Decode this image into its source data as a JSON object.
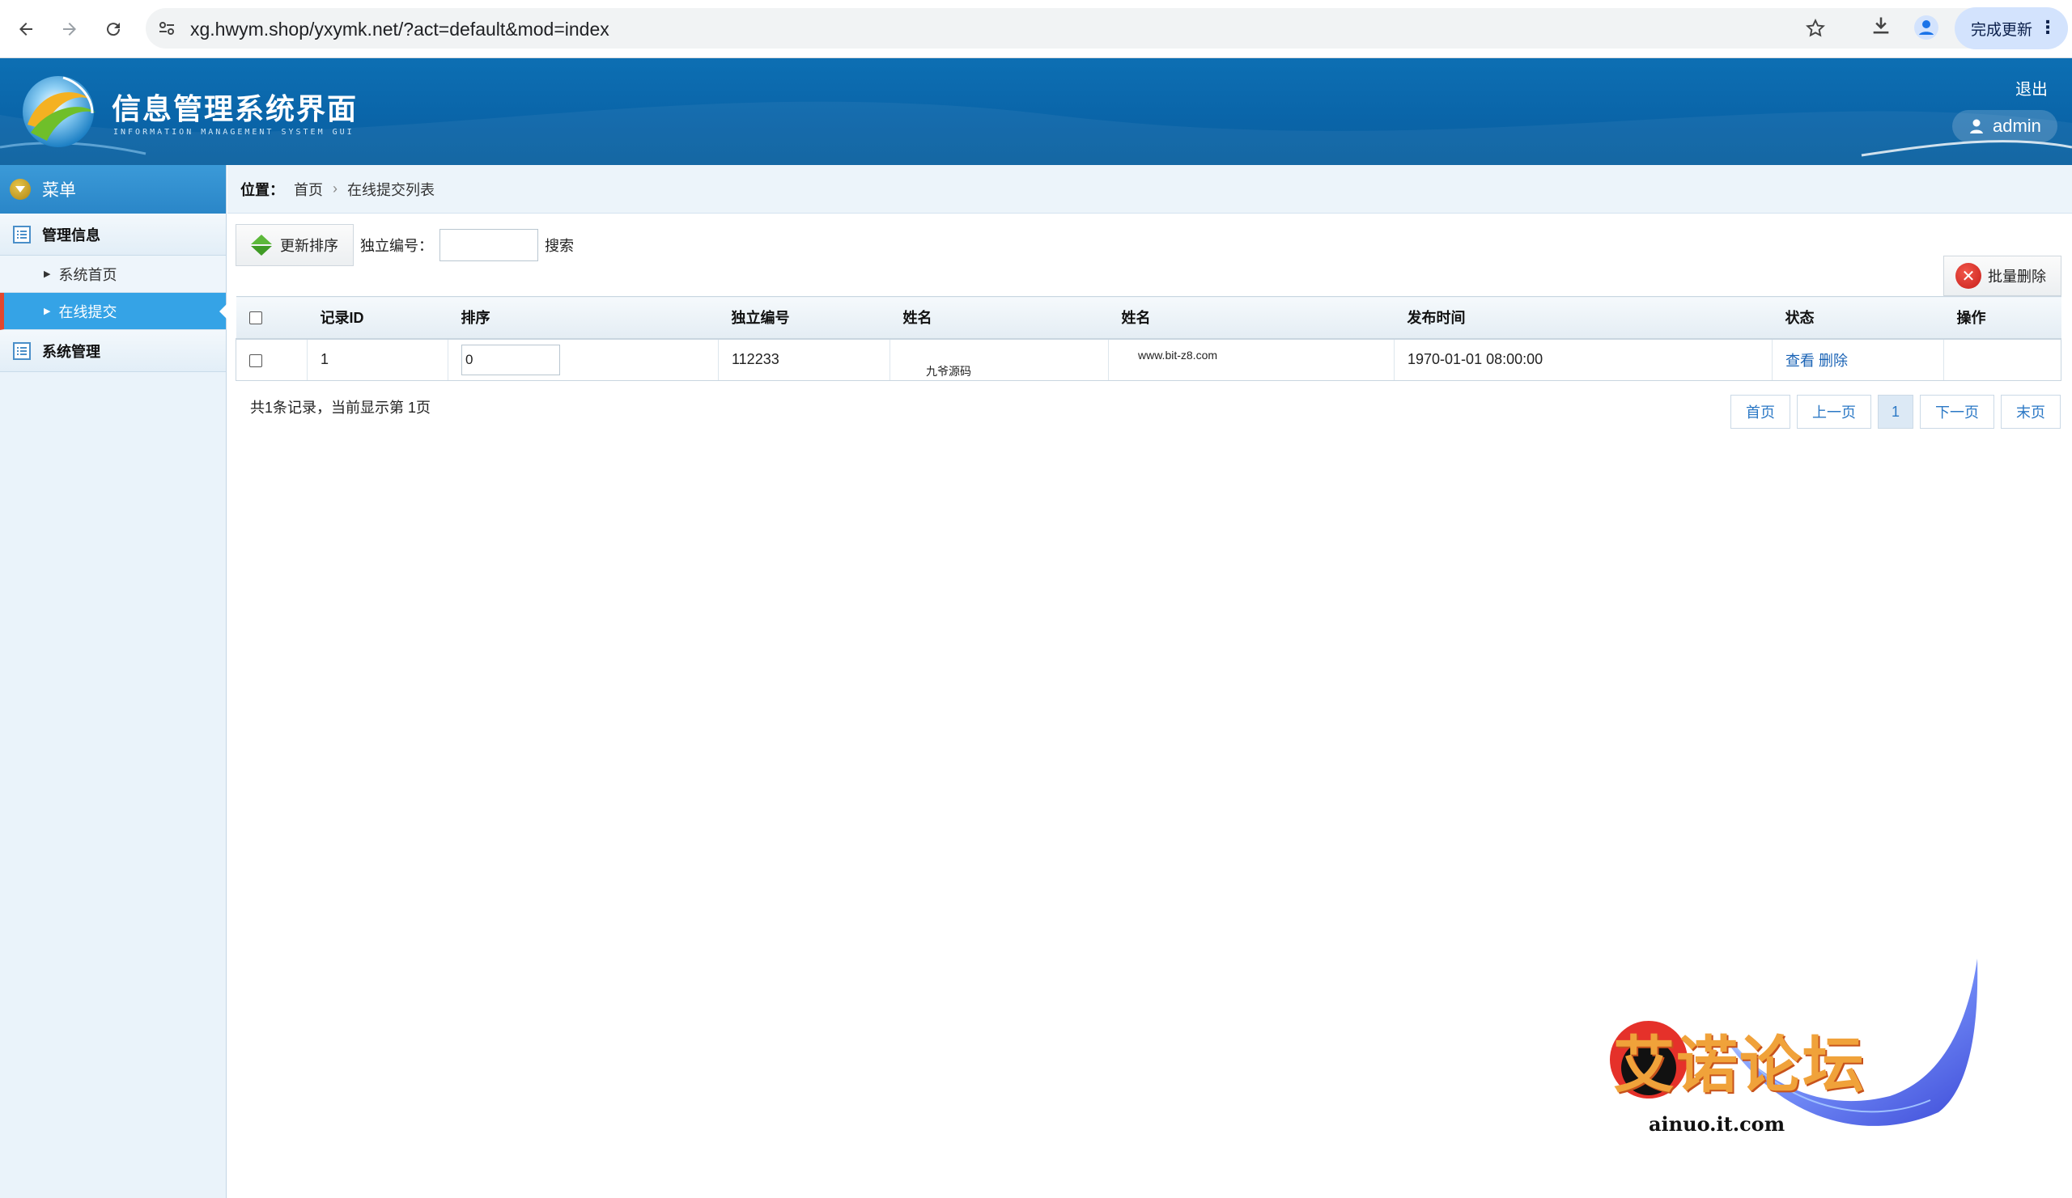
{
  "browser": {
    "url": "xg.hwym.shop/yxymk.net/?act=default&mod=index",
    "update_label": "完成更新"
  },
  "header": {
    "title": "信息管理系统界面",
    "subtitle": "INFORMATION MANAGEMENT SYSTEM GUI",
    "logout": "退出",
    "user": "admin"
  },
  "sidebar": {
    "menu_title": "菜单",
    "groups": [
      {
        "label": "管理信息",
        "items": [
          "系统首页",
          "在线提交"
        ]
      },
      {
        "label": "系统管理",
        "items": []
      }
    ],
    "active_item": "在线提交"
  },
  "breadcrumb": {
    "position_label": "位置：",
    "home": "首页",
    "current": "在线提交列表"
  },
  "toolbar": {
    "sort_button": "更新排序",
    "search_label": "独立编号：",
    "search_value": "",
    "search_button": "搜索",
    "batch_delete": "批量删除"
  },
  "table": {
    "headers": [
      "",
      "记录ID",
      "排序",
      "独立编号",
      "姓名",
      "姓名",
      "发布时间",
      "状态",
      "操作"
    ],
    "rows": [
      {
        "id": "1",
        "sort": "0",
        "code": "112233",
        "name1": "九爷源码",
        "name2": "www.bit-z8.com",
        "time": "1970-01-01 08:00:00",
        "view": "查看",
        "delete": "删除",
        "ops": ""
      }
    ]
  },
  "footer": {
    "records_text": "共1条记录，当前显示第 1页",
    "pager": {
      "first": "首页",
      "prev": "上一页",
      "current": "1",
      "next": "下一页",
      "last": "末页"
    }
  },
  "watermark": {
    "title": "艾诺论坛",
    "url": "ainuo.it.com"
  },
  "colors": {
    "header_blue": "#0a65a9",
    "active_item": "#35a3e6",
    "link": "#1a63b5",
    "watermark_orange": "#f0a23a"
  }
}
